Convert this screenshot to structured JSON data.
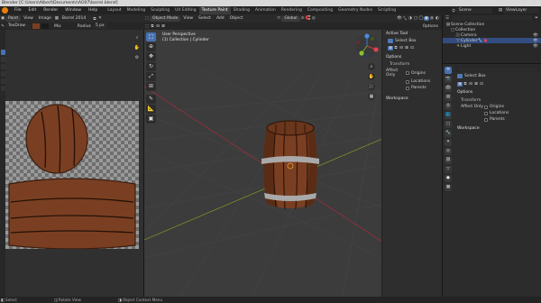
{
  "window": {
    "title": "Blender [C:\\Users\\Albert\\Documents\\AO07\\barrel.blend]",
    "controls": [
      "—",
      "☐",
      "✕"
    ]
  },
  "menubar": {
    "menus": [
      "File",
      "Edit",
      "Render",
      "Window",
      "Help"
    ],
    "workspaces": [
      "Layout",
      "Modeling",
      "Sculpting",
      "UV Editing",
      "Texture Paint",
      "Shading",
      "Animation",
      "Rendering",
      "Compositing",
      "Geometry Nodes",
      "Scripting"
    ],
    "active_workspace": "Texture Paint",
    "scene": "Scene",
    "view_layer": "ViewLayer"
  },
  "image_editor": {
    "mode": "Paint",
    "menus": [
      "View",
      "Image"
    ],
    "image_name": "Barrel 2014",
    "tool_brush": "TexDraw",
    "blend_mode": "Mix",
    "radius_label": "Radius",
    "radius_value": "5 px"
  },
  "viewport": {
    "mode": "Object Mode",
    "menus": [
      "View",
      "Select",
      "Add",
      "Object"
    ],
    "transform_orientation": "Global",
    "view_name": "User Perspective",
    "collection_info": "(1) Collection | Cylinder",
    "options_label": "Options",
    "npanel": {
      "active_tool_label": "Active Tool",
      "tool_name": "Select Box",
      "options_label": "Options",
      "transform_label": "Transform",
      "affect_only_label": "Affect Only",
      "affect_items": [
        "Origins",
        "Locations",
        "Parents"
      ],
      "workspace_label": "Workspace"
    }
  },
  "outliner": {
    "root": "Scene Collection",
    "collection": "Collection",
    "items": [
      "Camera",
      "Cylinder",
      "Light"
    ]
  },
  "properties": {
    "tool_name": "Select Box",
    "options_label": "Options",
    "transform_label": "Transform",
    "affect_only_label": "Affect Only",
    "affect_items": [
      "Origins",
      "Locations",
      "Parents"
    ],
    "workspace_label": "Workspace"
  },
  "statusbar": {
    "items": [
      "Select",
      "Rotate View",
      "Object Context Menu"
    ]
  },
  "colors": {
    "accent": "#4772b3",
    "wood": "#7a3f22",
    "wood_dark": "#4a2412",
    "metal": "#a9a9a9"
  }
}
